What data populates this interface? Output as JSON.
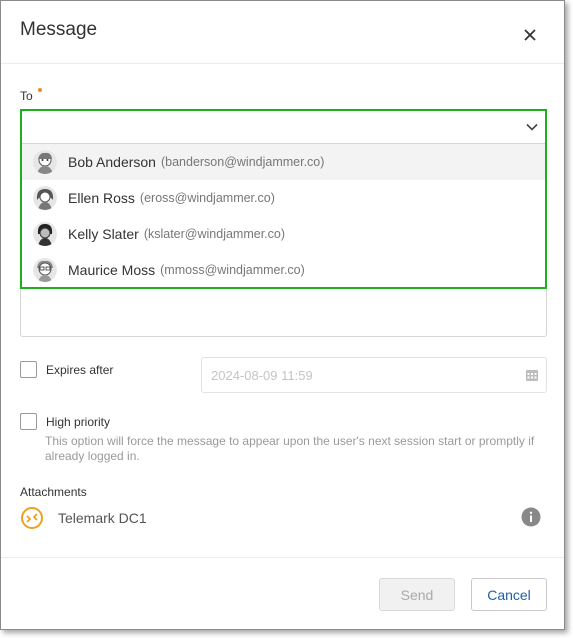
{
  "dialog": {
    "title": "Message"
  },
  "to": {
    "label": "To",
    "options": [
      {
        "name": "Bob Anderson",
        "email": "(banderson@windjammer.co)"
      },
      {
        "name": "Ellen Ross",
        "email": "(eross@windjammer.co)"
      },
      {
        "name": "Kelly Slater",
        "email": "(kslater@windjammer.co)"
      },
      {
        "name": "Maurice Moss",
        "email": "(mmoss@windjammer.co)"
      }
    ]
  },
  "expires": {
    "label": "Expires after",
    "placeholder": "2024-08-09 11:59",
    "checked": false
  },
  "priority": {
    "label": "High priority",
    "help": "This option will force the message to appear upon the user's next session start or promptly if already logged in.",
    "checked": false
  },
  "attachments": {
    "label": "Attachments",
    "items": [
      {
        "name": "Telemark DC1",
        "icon": "remote-connection-icon"
      }
    ]
  },
  "footer": {
    "send_label": "Send",
    "cancel_label": "Cancel"
  },
  "colors": {
    "focus_border": "#1cb01c",
    "required": "#f08a24",
    "attachment_icon": "#f0a020",
    "link": "#1f5fa8"
  }
}
